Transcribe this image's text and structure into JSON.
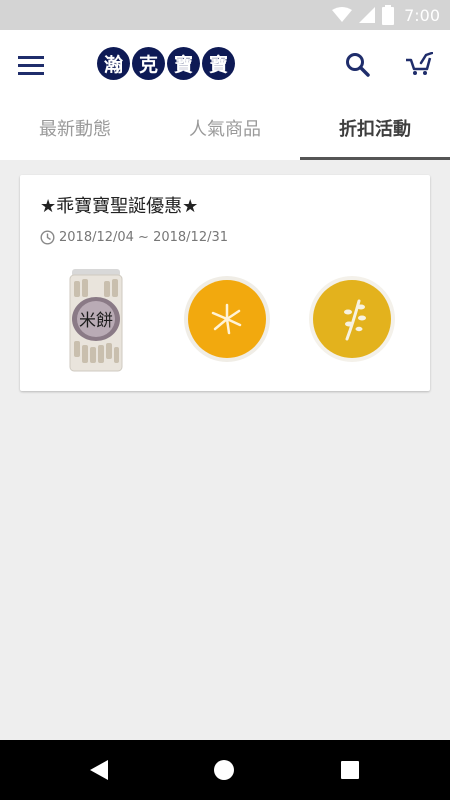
{
  "status_bar": {
    "time": "7:00",
    "icons": [
      "wifi-icon",
      "signal-icon",
      "battery-icon"
    ]
  },
  "app_bar": {
    "logo_chars": [
      "瀚",
      "克",
      "寶",
      "寶"
    ],
    "icons": [
      "menu-icon",
      "search-icon",
      "cart-icon"
    ]
  },
  "tabs": [
    {
      "label": "最新動態",
      "active": false
    },
    {
      "label": "人氣商品",
      "active": false
    },
    {
      "label": "折扣活動",
      "active": true
    }
  ],
  "promo_card": {
    "title": "★乖寶寶聖誕優惠★",
    "date_range": "2018/12/04 ~ 2018/12/31",
    "date_icon": "clock-icon",
    "product_images": [
      {
        "kind": "jar",
        "label_text": "米餅"
      },
      {
        "kind": "orange-soup-plate"
      },
      {
        "kind": "yellow-soup-plate"
      }
    ]
  },
  "nav_bar": {
    "icons": [
      "back-icon",
      "home-icon",
      "recents-icon"
    ]
  },
  "colors": {
    "brand_navy": "#0e1a55",
    "accent": "#1f2d6b",
    "background": "#eeeeee",
    "tab_inactive": "#9a9a9a",
    "tab_active": "#3e3e3e"
  }
}
